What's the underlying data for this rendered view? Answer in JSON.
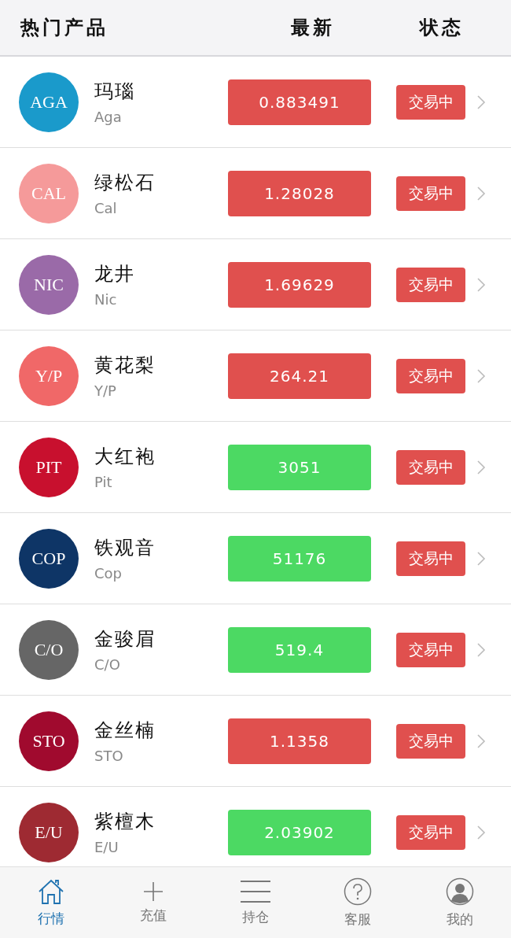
{
  "header": {
    "product": "热门产品",
    "latest": "最新",
    "status": "状态"
  },
  "products": [
    {
      "badge": "AGA",
      "color": "#1a9acb",
      "name": "玛瑙",
      "code": "Aga",
      "price": {
        "value": "0.883491",
        "color": "#e0504e"
      },
      "status": "交易中"
    },
    {
      "badge": "CAL",
      "color": "#f59a9a",
      "name": "绿松石",
      "code": "Cal",
      "price": {
        "value": "1.28028",
        "color": "#e0504e"
      },
      "status": "交易中"
    },
    {
      "badge": "NIC",
      "color": "#9a6aa8",
      "name": "龙井",
      "code": "Nic",
      "price": {
        "value": "1.69629",
        "color": "#e0504e"
      },
      "status": "交易中"
    },
    {
      "badge": "Y/P",
      "color": "#f06868",
      "name": "黄花梨",
      "code": "Y/P",
      "price": {
        "value": "264.21",
        "color": "#e0504e"
      },
      "status": "交易中"
    },
    {
      "badge": "PIT",
      "color": "#c8102e",
      "name": "大红袍",
      "code": "Pit",
      "price": {
        "value": "3051",
        "color": "#4cd963"
      },
      "status": "交易中"
    },
    {
      "badge": "COP",
      "color": "#0e3566",
      "name": "铁观音",
      "code": "Cop",
      "price": {
        "value": "51176",
        "color": "#4cd963"
      },
      "status": "交易中"
    },
    {
      "badge": "C/O",
      "color": "#666666",
      "name": "金骏眉",
      "code": "C/O",
      "price": {
        "value": "519.4",
        "color": "#4cd963"
      },
      "status": "交易中"
    },
    {
      "badge": "STO",
      "color": "#a00a2e",
      "name": "金丝楠",
      "code": "STO",
      "price": {
        "value": "1.1358",
        "color": "#e0504e"
      },
      "status": "交易中"
    },
    {
      "badge": "E/U",
      "color": "#9e2a32",
      "name": "紫檀木",
      "code": "E/U",
      "price": {
        "value": "2.03902",
        "color": "#4cd963"
      },
      "status": "交易中"
    }
  ],
  "tabs": [
    {
      "kind": "home",
      "label": "行情",
      "selected": true
    },
    {
      "kind": "plus",
      "label": "充值",
      "selected": false
    },
    {
      "kind": "list",
      "label": "持仓",
      "selected": false
    },
    {
      "kind": "help",
      "label": "客服",
      "selected": false
    },
    {
      "kind": "user",
      "label": "我的",
      "selected": false
    }
  ]
}
